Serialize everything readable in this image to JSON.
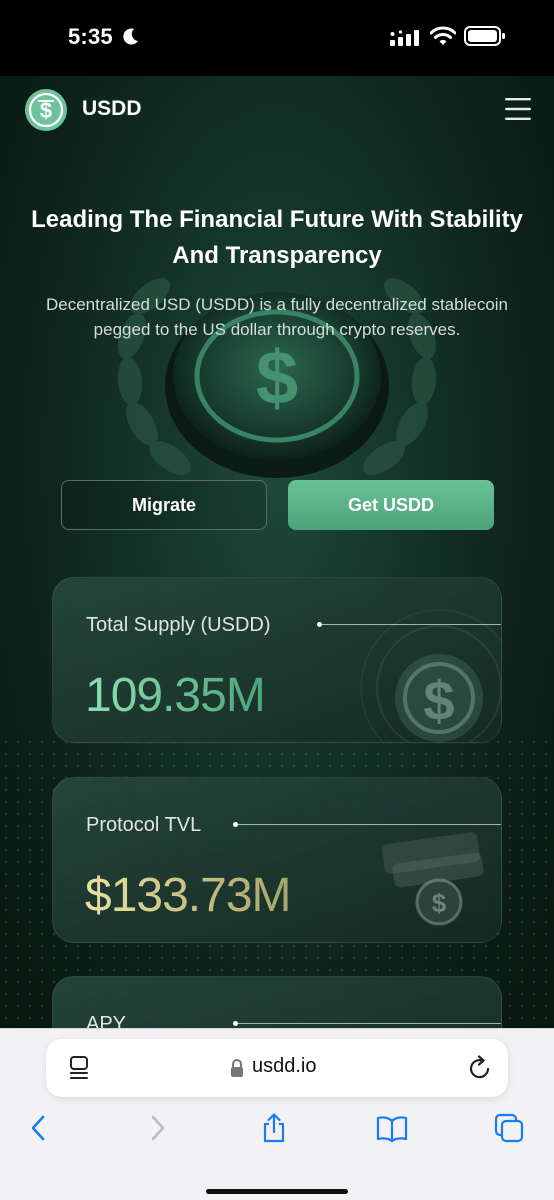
{
  "status_bar": {
    "time": "5:35",
    "icons": [
      "moon-icon",
      "signal-icon",
      "wifi-icon",
      "battery-icon"
    ]
  },
  "header": {
    "brand": "USDD",
    "logo_icon": "usdd-logo-icon",
    "menu_icon": "hamburger-menu-icon"
  },
  "hero": {
    "title": "Leading The Financial Future With Stability And Transparency",
    "description": "Decentralized USD (USDD) is a fully decentralized stablecoin pegged to the US dollar through crypto reserves."
  },
  "buttons": {
    "migrate": "Migrate",
    "get_usdd": "Get USDD"
  },
  "stats": [
    {
      "label": "Total Supply (USDD)",
      "value": "109.35M"
    },
    {
      "label": "Protocol TVL",
      "value": "$133.73M"
    },
    {
      "label": "APY",
      "value": ""
    }
  ],
  "browser": {
    "url": "usdd.io",
    "icons": [
      "reader-icon",
      "lock-icon",
      "reload-icon",
      "back-icon",
      "forward-icon",
      "share-icon",
      "bookmarks-icon",
      "tabs-icon"
    ]
  },
  "colors": {
    "accent_green": "#5fb388",
    "background": "#143328",
    "value_gold": "#d8d08a",
    "ios_blue": "#1a7cf5"
  }
}
